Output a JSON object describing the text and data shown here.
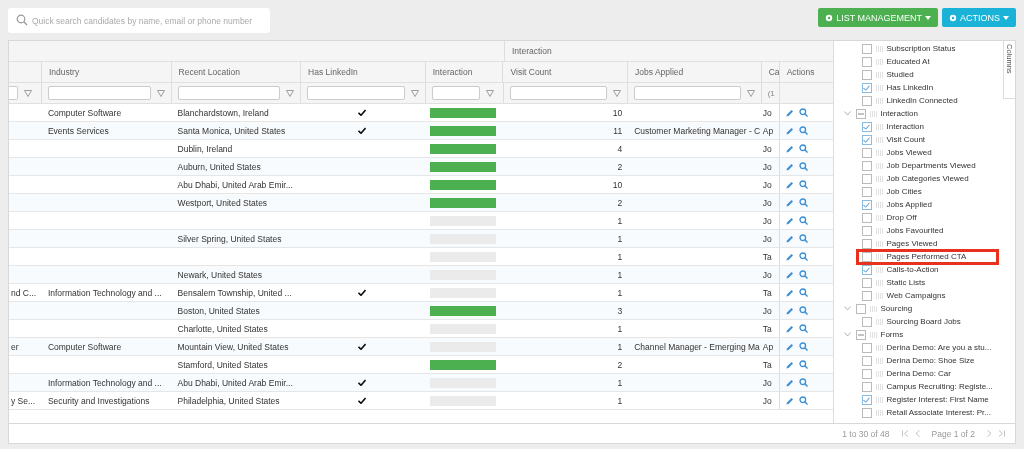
{
  "search": {
    "placeholder": "Quick search candidates by name, email or phone number"
  },
  "toolbar": {
    "buttons": [
      {
        "label": "LIST MANAGEMENT",
        "kind": "green"
      },
      {
        "label": "ACTIONS",
        "kind": "blue"
      }
    ]
  },
  "table": {
    "group_header": "Interaction",
    "columns": [
      {
        "label": "Industry"
      },
      {
        "label": "Recent Location"
      },
      {
        "label": "Has LinkedIn"
      },
      {
        "label": "Interaction"
      },
      {
        "label": "Visit Count"
      },
      {
        "label": "Jobs Applied"
      },
      {
        "label": "Ca",
        "filter_text": "(1"
      },
      {
        "label": "Actions"
      }
    ],
    "rows": [
      {
        "column_1": "",
        "industry": "Computer Software",
        "location": "Blanchardstown, Ireland",
        "has_linkedin": true,
        "level": 1,
        "visit_count": "10",
        "jobs_applied": "",
        "column_8": "Jo"
      },
      {
        "column_1": "",
        "industry": "Events Services",
        "location": "Santa Monica, United States",
        "has_linkedin": true,
        "level": 1,
        "visit_count": "11",
        "jobs_applied": "Customer Marketing Manager - C",
        "column_8": "Ap"
      },
      {
        "column_1": "",
        "industry": "",
        "location": "Dublin, Ireland",
        "has_linkedin": false,
        "level": 1,
        "visit_count": "4",
        "jobs_applied": "",
        "column_8": "Jo"
      },
      {
        "column_1": "",
        "industry": "",
        "location": "Auburn, United States",
        "has_linkedin": false,
        "level": 1,
        "visit_count": "2",
        "jobs_applied": "",
        "column_8": "Jo"
      },
      {
        "column_1": "",
        "industry": "",
        "location": "Abu Dhabi, United Arab Emir...",
        "has_linkedin": false,
        "level": 1,
        "visit_count": "10",
        "jobs_applied": "",
        "column_8": "Jo"
      },
      {
        "column_1": "",
        "industry": "",
        "location": "Westport, United States",
        "has_linkedin": false,
        "level": 1,
        "visit_count": "2",
        "jobs_applied": "",
        "column_8": "Jo"
      },
      {
        "column_1": "",
        "industry": "",
        "location": "",
        "has_linkedin": false,
        "level": 0,
        "visit_count": "1",
        "jobs_applied": "",
        "column_8": "Jo"
      },
      {
        "column_1": "",
        "industry": "",
        "location": "Silver Spring, United States",
        "has_linkedin": false,
        "level": 0,
        "visit_count": "1",
        "jobs_applied": "",
        "column_8": "Jo"
      },
      {
        "column_1": "",
        "industry": "",
        "location": "",
        "has_linkedin": false,
        "level": 0,
        "visit_count": "1",
        "jobs_applied": "",
        "column_8": "Ta"
      },
      {
        "column_1": "",
        "industry": "",
        "location": "Newark, United States",
        "has_linkedin": false,
        "level": 0,
        "visit_count": "1",
        "jobs_applied": "",
        "column_8": "Jo"
      },
      {
        "column_1": "nd C...",
        "industry": "Information Technology and ...",
        "location": "Bensalem Township, United ...",
        "has_linkedin": true,
        "level": 0,
        "visit_count": "1",
        "jobs_applied": "",
        "column_8": "Ta"
      },
      {
        "column_1": "",
        "industry": "",
        "location": "Boston, United States",
        "has_linkedin": false,
        "level": 1,
        "visit_count": "3",
        "jobs_applied": "",
        "column_8": "Jo"
      },
      {
        "column_1": "",
        "industry": "",
        "location": "Charlotte, United States",
        "has_linkedin": false,
        "level": 0,
        "visit_count": "1",
        "jobs_applied": "",
        "column_8": "Ta"
      },
      {
        "column_1": "er",
        "industry": "Computer Software",
        "location": "Mountain View, United States",
        "has_linkedin": true,
        "level": 0,
        "visit_count": "1",
        "jobs_applied": "Channel Manager - Emerging Ma",
        "column_8": "Ap"
      },
      {
        "column_1": "",
        "industry": "",
        "location": "Stamford, United States",
        "has_linkedin": false,
        "level": 1,
        "visit_count": "2",
        "jobs_applied": "",
        "column_8": "Ta"
      },
      {
        "column_1": "",
        "industry": "Information Technology and ...",
        "location": "Abu Dhabi, United Arab Emir...",
        "has_linkedin": true,
        "level": 0,
        "visit_count": "1",
        "jobs_applied": "",
        "column_8": "Jo"
      },
      {
        "column_1": "y Se...",
        "industry": "Security and Investigations",
        "location": "Philadelphia, United States",
        "has_linkedin": true,
        "level": 0,
        "visit_count": "1",
        "jobs_applied": "",
        "column_8": "Jo"
      }
    ]
  },
  "columns_panel": {
    "tab_label": "Columns",
    "items": [
      {
        "label": "Subscription Status",
        "checked": false
      },
      {
        "label": "Educated At",
        "checked": false
      },
      {
        "label": "Studied",
        "checked": false
      },
      {
        "label": "Has LinkedIn",
        "checked": true
      },
      {
        "label": "LinkedIn Connected",
        "checked": false
      },
      {
        "label": "Interaction",
        "checked": false,
        "indeterminate": true,
        "expanded": true,
        "children": [
          {
            "label": "Interaction",
            "checked": true
          },
          {
            "label": "Visit Count",
            "checked": true
          },
          {
            "label": "Jobs Viewed",
            "checked": false
          },
          {
            "label": "Job Departments Viewed",
            "checked": false
          },
          {
            "label": "Job Categories Viewed",
            "checked": false
          },
          {
            "label": "Job Cities",
            "checked": false
          },
          {
            "label": "Jobs Applied",
            "checked": true
          },
          {
            "label": "Drop Off",
            "checked": false
          },
          {
            "label": "Jobs Favourited",
            "checked": false
          },
          {
            "label": "Pages Viewed",
            "checked": false
          },
          {
            "label": "Pages Performed CTA",
            "checked": false,
            "highlighted": true
          },
          {
            "label": "Calls-to-Action",
            "checked": true
          },
          {
            "label": "Static Lists",
            "checked": false
          },
          {
            "label": "Web Campaigns",
            "checked": false
          }
        ]
      },
      {
        "label": "Sourcing",
        "checked": false,
        "indeterminate": false,
        "expanded": true,
        "children": [
          {
            "label": "Sourcing Board Jobs",
            "checked": false
          }
        ]
      },
      {
        "label": "Forms",
        "checked": false,
        "indeterminate": true,
        "expanded": true,
        "children": [
          {
            "label": "Derina Demo: Are you a stu...",
            "checked": false
          },
          {
            "label": "Derina Demo: Shoe Size",
            "checked": false
          },
          {
            "label": "Derina Demo: Car",
            "checked": false
          },
          {
            "label": "Campus Recruiting: Registe...",
            "checked": false
          },
          {
            "label": "Register Interest: First Name",
            "checked": true
          },
          {
            "label": "Retail Associate Interest: Pr...",
            "checked": false
          }
        ]
      }
    ]
  },
  "pager": {
    "summary": "1 to 30 of 48",
    "page": "Page 1 of 2"
  }
}
